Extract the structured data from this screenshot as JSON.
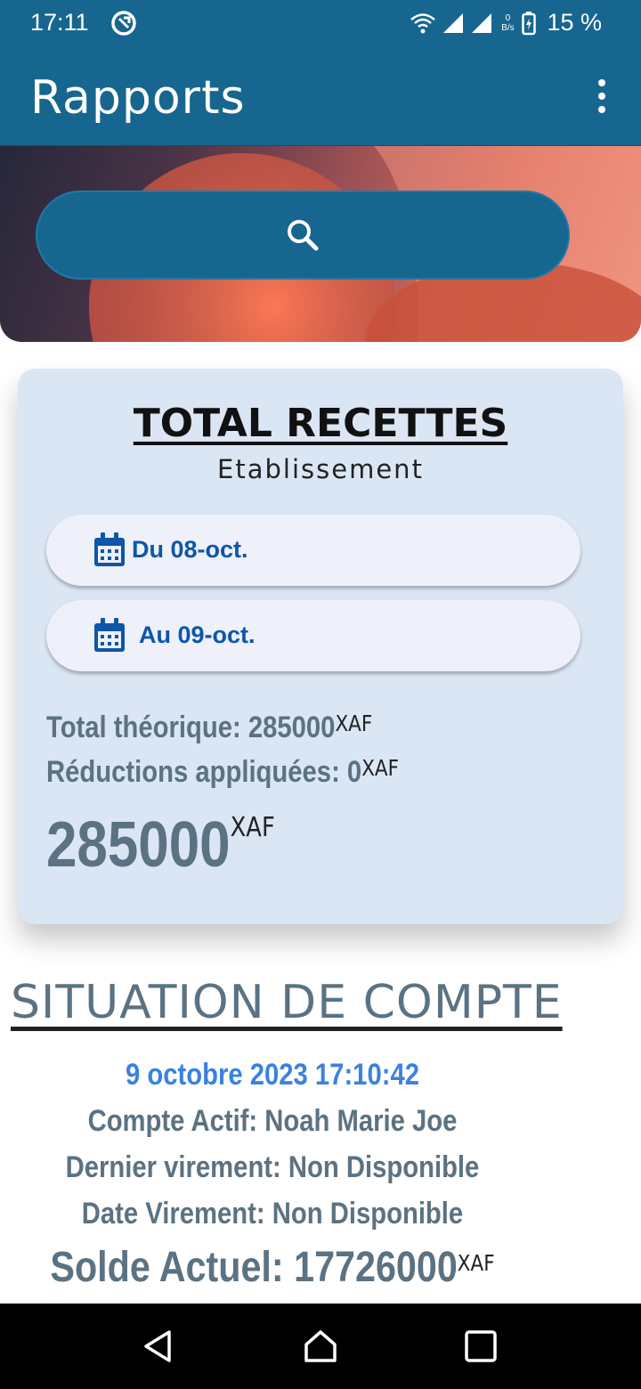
{
  "status_bar": {
    "time": "17:11",
    "net_speed_value": "0",
    "net_speed_unit": "B/s",
    "battery": "15 %"
  },
  "app_bar": {
    "title": "Rapports",
    "menu_icon": "more-vert-icon"
  },
  "search": {
    "icon": "search-icon"
  },
  "card": {
    "title": "TOTAL RECETTES",
    "subtitle": "Etablissement",
    "from_label": "Du 08-oct.",
    "to_label": "Au 09-oct.",
    "theoretical_label": "Total théorique: 285000",
    "theoretical_unit": "XAF",
    "reductions_label": "Réductions appliquées: 0",
    "reductions_unit": "XAF",
    "total_value": "285000",
    "total_unit": "XAF"
  },
  "situation": {
    "title": "SITUATION DE COMPTE",
    "datetime": "9 octobre 2023 17:10:42",
    "account": "Compte Actif: Noah Marie Joe",
    "last_transfer": "Dernier virement: Non Disponible",
    "transfer_date": "Date Virement: Non Disponible",
    "balance_label": "Solde Actuel: 17726000",
    "balance_unit": "XAF"
  },
  "colors": {
    "primary": "#17668f",
    "card_bg": "#dbe6f5",
    "date_text": "#0d56a8",
    "value_text": "#5b7282",
    "accent_date": "#3b82e0"
  }
}
